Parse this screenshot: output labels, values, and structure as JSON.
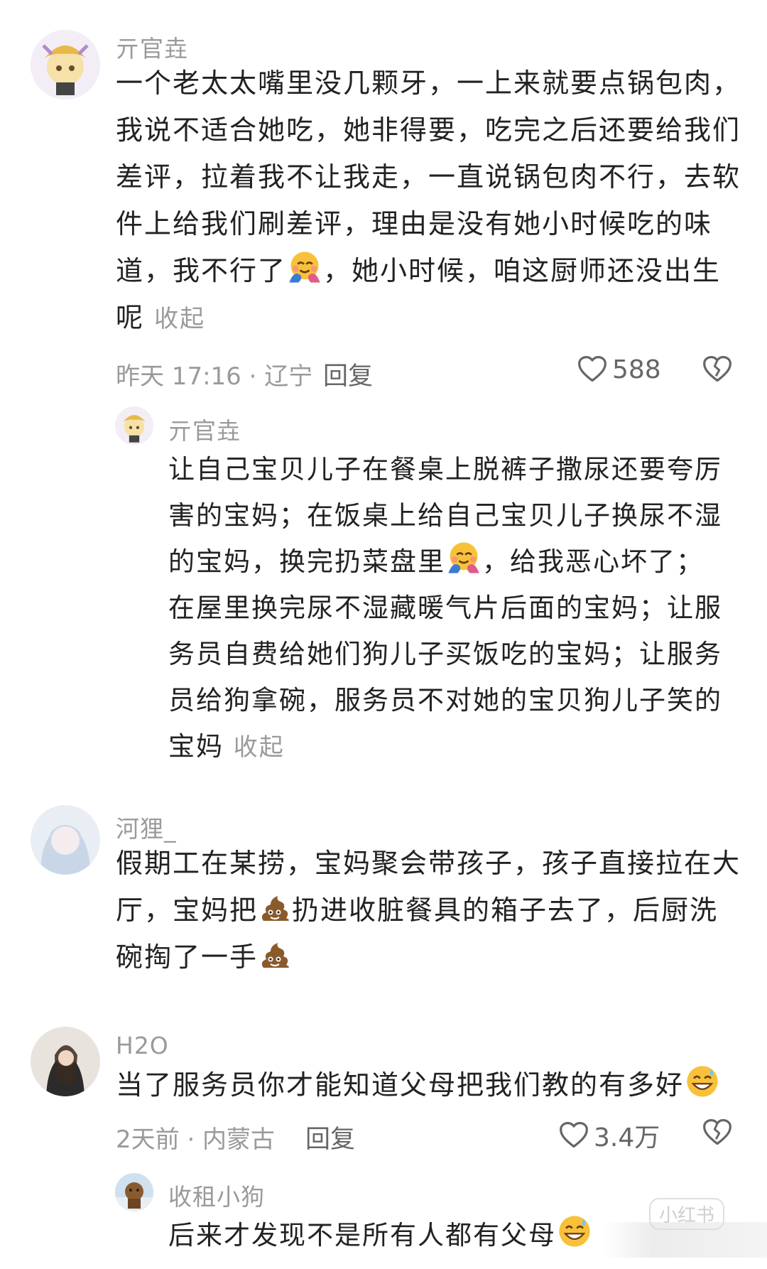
{
  "comments": [
    {
      "user": "亓官垚",
      "text_lines": [
        "一个老太太嘴里没几颗牙，一上来就要点锅包肉，",
        "我说不适合她吃，她非得要，吃完之后还要给我们",
        "差评，拉着我不让我走，一直说锅包肉不行，去软",
        "件上给我们刷差评，理由是没有她小时候吃的味",
        "道，我不行了",
        "，她小时候，咱这厨师还没出生",
        "呢"
      ],
      "collapse": "收起",
      "time_location": "昨天 17:16 · 辽宁",
      "reply_label": "回复",
      "likes": "588"
    },
    {
      "user": "亓官垚",
      "text_lines": [
        "让自己宝贝儿子在餐桌上脱裤子撒尿还要夸厉",
        "害的宝妈；在饭桌上给自己宝贝儿子换尿不湿",
        "的宝妈，换完扔菜盘里",
        "，给我恶心坏了；",
        "在屋里换完尿不湿藏暖气片后面的宝妈；让服",
        "务员自费给她们狗儿子买饭吃的宝妈；让服务",
        "员给狗拿碗，服务员不对她的宝贝狗儿子笑的",
        "宝妈"
      ],
      "collapse": "收起"
    },
    {
      "user": "河狸_",
      "text_lines": [
        "假期工在某捞，宝妈聚会带孩子，孩子直接拉在大",
        "厅，宝妈把",
        "扔进收脏餐具的箱子去了，后厨洗",
        "碗掏了一手"
      ]
    },
    {
      "user": "H2O",
      "text_lines": [
        "当了服务员你才能知道父母把我们教的有多好"
      ],
      "time_location": "2天前 · 内蒙古",
      "reply_label": "回复",
      "likes": "3.4万"
    },
    {
      "user": "收租小狗",
      "text_lines": [
        "后来才发现不是所有人都有父母"
      ]
    }
  ],
  "watermark": "小红书",
  "icons": {
    "hug": "hugging-face-emoji",
    "poop": "pile-of-poo-emoji",
    "grin": "grinning-sweat-emoji",
    "heart": "heart-icon",
    "dislike": "broken-heart-icon"
  }
}
